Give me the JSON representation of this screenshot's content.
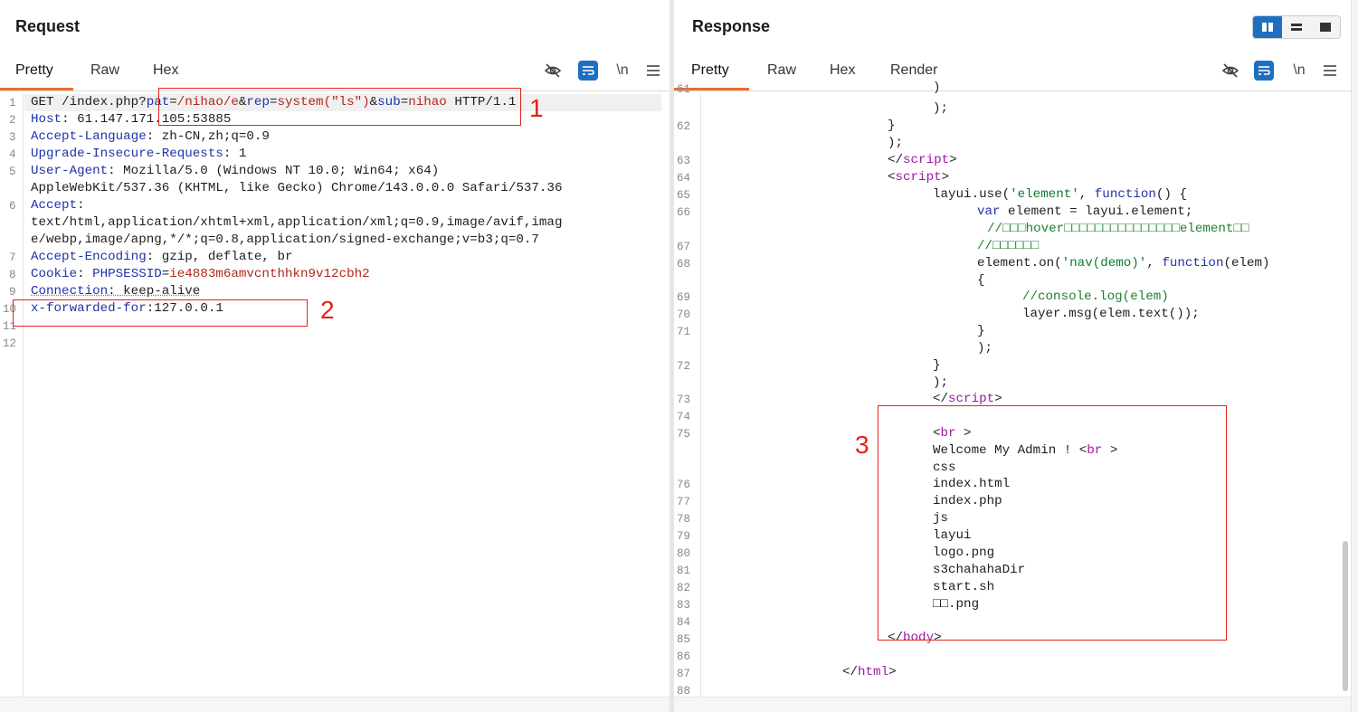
{
  "request": {
    "title": "Request",
    "tabs": [
      "Pretty",
      "Raw",
      "Hex"
    ],
    "icons": {
      "eye_off": "eye-off-icon",
      "wrap": "wrap-lines-icon",
      "newline": "\\n",
      "menu": "menu-icon"
    }
  },
  "response": {
    "title": "Response",
    "tabs": [
      "Pretty",
      "Raw",
      "Hex",
      "Render"
    ],
    "icons": {
      "eye_off": "eye-off-icon",
      "wrap": "wrap-lines-icon",
      "newline": "\\n",
      "menu": "menu-icon"
    }
  },
  "annotations": [
    "1",
    "2",
    "3"
  ],
  "colors": {
    "highlight": "#e2231a",
    "accent_tab": "#e8702a",
    "button_blue": "#1e6fbf"
  }
}
